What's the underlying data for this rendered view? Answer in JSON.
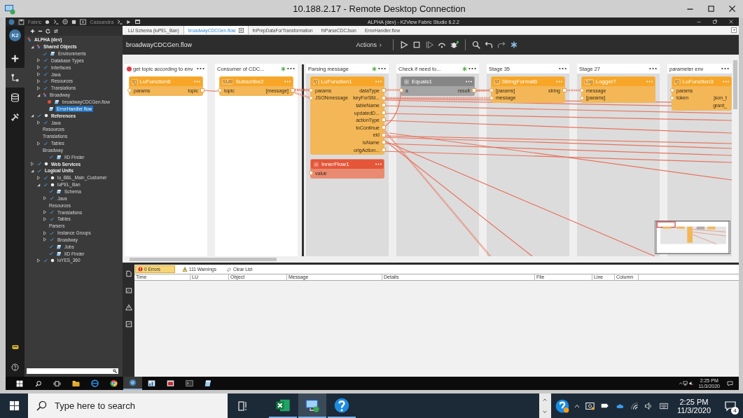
{
  "rdp_window": {
    "title": "10.188.2.17 - Remote Desktop Connection"
  },
  "app": {
    "labels": [
      "Fabric",
      "Cassandra"
    ],
    "title": "ALPHA (dev) - K2View Fabric Studio 6.2.2"
  },
  "rail": {
    "logo": "K2",
    "items": [
      {
        "kind": "add",
        "selected": false
      },
      {
        "kind": "flow",
        "selected": true
      },
      {
        "kind": "database",
        "selected": false
      },
      {
        "kind": "tools",
        "selected": false
      }
    ]
  },
  "tree": {
    "items": [
      {
        "label": "ALPHA (dev)",
        "kind": "project",
        "checked": false,
        "selected": false,
        "children": [
          {
            "label": "Shared Objects",
            "kind": "project",
            "checked": false,
            "selected": false,
            "expanded": true,
            "children": [
              {
                "label": "Environments",
                "kind": "file",
                "checked": true,
                "selected": false
              },
              {
                "label": "Database Types",
                "kind": "folder",
                "checked": true,
                "selected": false,
                "expanded": false
              },
              {
                "label": "Interfaces",
                "kind": "folder",
                "checked": true,
                "selected": false,
                "expanded": false
              },
              {
                "label": "Java",
                "kind": "folder",
                "checked": true,
                "selected": false,
                "expanded": false
              },
              {
                "label": "Resources",
                "kind": "folder",
                "checked": true,
                "selected": false,
                "expanded": false
              },
              {
                "label": "Translations",
                "kind": "folder",
                "checked": true,
                "selected": false,
                "expanded": false
              },
              {
                "label": "Broadway",
                "kind": "project",
                "checked": false,
                "selected": false,
                "expanded": true,
                "children": [
                  {
                    "label": "broadwayCDCGen.flow",
                    "kind": "file",
                    "checked": false,
                    "modified": true,
                    "selected": false
                  },
                  {
                    "label": "ErrorHandler.flow",
                    "kind": "file",
                    "checked": false,
                    "modified": false,
                    "selected": true
                  }
                ]
              }
            ]
          },
          {
            "label": "References",
            "kind": "dot",
            "checked": true,
            "selected": false,
            "expanded": true,
            "children": [
              {
                "label": "Java",
                "kind": "folder",
                "checked": true,
                "selected": false,
                "expanded": false
              },
              {
                "label": "Resources",
                "kind": "text",
                "checked": false,
                "selected": false
              },
              {
                "label": "Translations",
                "kind": "text",
                "checked": false,
                "selected": false
              },
              {
                "label": "Tables",
                "kind": "folder",
                "checked": true,
                "selected": false,
                "expanded": false
              },
              {
                "label": "Broadway",
                "kind": "text",
                "checked": false,
                "selected": false,
                "children": [
                  {
                    "label": "IID Finder",
                    "kind": "file",
                    "checked": true,
                    "selected": false
                  }
                ]
              }
            ]
          },
          {
            "label": "Web Services",
            "kind": "dot",
            "checked": true,
            "selected": false,
            "expanded": false
          },
          {
            "label": "Logical Units",
            "kind": "text",
            "checked": true,
            "selected": false,
            "expanded": true,
            "children": [
              {
                "label": "lu_BBL_Main_Customer",
                "kind": "dot",
                "checked": true,
                "selected": false,
                "expanded": false
              },
              {
                "label": "luPEL_Ban",
                "kind": "dot",
                "checked": true,
                "selected": false,
                "expanded": true,
                "children": [
                  {
                    "label": "Schema",
                    "kind": "file",
                    "checked": true,
                    "selected": false
                  },
                  {
                    "label": "Java",
                    "kind": "folder",
                    "checked": true,
                    "selected": false,
                    "expanded": false
                  },
                  {
                    "label": "Resources",
                    "kind": "text",
                    "checked": false,
                    "selected": false
                  },
                  {
                    "label": "Translations",
                    "kind": "folder",
                    "checked": true,
                    "selected": false,
                    "expanded": false
                  },
                  {
                    "label": "Tables",
                    "kind": "folder",
                    "checked": true,
                    "selected": false,
                    "expanded": false
                  },
                  {
                    "label": "Parsers",
                    "kind": "text",
                    "checked": false,
                    "selected": false
                  },
                  {
                    "label": "Instance Groups",
                    "kind": "folder",
                    "checked": true,
                    "selected": false,
                    "expanded": false
                  },
                  {
                    "label": "Broadway",
                    "kind": "folder",
                    "checked": true,
                    "selected": false,
                    "expanded": false
                  },
                  {
                    "label": "Jobs",
                    "kind": "file",
                    "checked": true,
                    "selected": false
                  },
                  {
                    "label": "IID Finder",
                    "kind": "file",
                    "checked": true,
                    "selected": false
                  }
                ]
              },
              {
                "label": "luYES_360",
                "kind": "dot",
                "checked": true,
                "selected": false,
                "expanded": false
              }
            ]
          }
        ]
      }
    ]
  },
  "tabs": [
    {
      "label": "LU Schema (luPEL_Ban)",
      "selected": false,
      "closable": false
    },
    {
      "label": "broadwayCDCGen.flow",
      "selected": true,
      "closable": true
    },
    {
      "label": "fnPrepDataForTransformation",
      "selected": false,
      "closable": false
    },
    {
      "label": "fnParseCDCJson",
      "selected": false,
      "closable": false
    },
    {
      "label": "ErrorHandler.flow",
      "selected": false,
      "closable": false
    }
  ],
  "flow": {
    "title": "broadwayCDCGen.flow",
    "actions": "Actions"
  },
  "stages": [
    {
      "title": "get  topic according to env",
      "error": true,
      "starred": false,
      "shaded": false,
      "divider_before": false,
      "nodes": [
        {
          "kind": "function",
          "badge": "f()",
          "title": "LuFunction6",
          "rows": [
            {
              "in": "params",
              "out": "topic"
            }
          ]
        }
      ]
    },
    {
      "title": "Consumer of CDC...",
      "error": false,
      "starred": true,
      "shaded": false,
      "divider_before": false,
      "nodes": [
        {
          "kind": "function",
          "badge": "SUB",
          "title": "Subscribe2",
          "rows": [
            {
              "in": "topic",
              "out": "[message]"
            }
          ]
        }
      ]
    },
    {
      "title": "Parsing message",
      "error": false,
      "starred": true,
      "shaded": true,
      "divider_before": true,
      "nodes": [
        {
          "kind": "function",
          "badge": "f()",
          "title": "LuFunction1",
          "rows": [
            {
              "in": "params",
              "out": "dataType"
            },
            {
              "in": "JSONmessage",
              "out": "keyForSfd..."
            },
            {
              "out": "tableName"
            },
            {
              "out": "updatedD..."
            },
            {
              "out": "actionType"
            },
            {
              "out": "toContinue"
            },
            {
              "out": "eid"
            },
            {
              "out": "luName"
            },
            {
              "out": "origAction..."
            }
          ]
        },
        {
          "kind": "inner_flow",
          "title": "InnerFlow1",
          "rows": [
            {
              "in": "value"
            }
          ]
        }
      ]
    },
    {
      "title": "Check if need to...",
      "error": false,
      "starred": true,
      "shaded": true,
      "divider_before": false,
      "nodes": [
        {
          "kind": "condition",
          "title": "Equals1",
          "rows": [
            {
              "in": "a",
              "out": "result"
            }
          ]
        }
      ]
    },
    {
      "title": "Stage 35",
      "error": false,
      "starred": false,
      "shaded": true,
      "divider_before": false,
      "nodes": [
        {
          "kind": "function",
          "badge": "Sf",
          "title": "StringFormat6",
          "rows": [
            {
              "in": "[params]",
              "out": "string"
            },
            {
              "in": "message"
            }
          ]
        }
      ]
    },
    {
      "title": "Stage 27",
      "error": false,
      "starred": false,
      "shaded": true,
      "divider_before": false,
      "nodes": [
        {
          "kind": "function",
          "badge": "Log",
          "title": "Logger7",
          "rows": [
            {
              "in": "message"
            },
            {
              "in": "[params]"
            }
          ]
        }
      ]
    },
    {
      "title": "parameter env",
      "error": false,
      "starred": false,
      "shaded": true,
      "divider_before": false,
      "nodes": [
        {
          "kind": "function",
          "badge": "f()",
          "title": "LuFunction3",
          "rows": [
            {
              "in": "params"
            },
            {
              "in": "token",
              "out": "json_t"
            },
            {
              "out": "grant_"
            }
          ]
        }
      ]
    }
  ],
  "problems": {
    "errors": {
      "label": "0 Errors",
      "selected": true
    },
    "warnings": {
      "label": "111 Warnings",
      "selected": false
    },
    "clear": "Clear List",
    "columns": [
      "Time",
      "LU",
      "Object",
      "Message",
      "Details",
      "File",
      "Line",
      "Column"
    ]
  },
  "remote_taskbar": {
    "apps": [
      {
        "kind": "folder",
        "selected": false
      },
      {
        "kind": "globe",
        "selected": false
      },
      {
        "kind": "wheel",
        "selected": false
      },
      {
        "kind": "logo",
        "selected": true
      },
      {
        "kind": "chart",
        "selected": false
      },
      {
        "kind": "window",
        "selected": false
      },
      {
        "kind": "terminal",
        "selected": false
      },
      {
        "kind": "note",
        "selected": false
      }
    ],
    "time": "2:25 PM",
    "date": "11/3/2020"
  },
  "taskbar": {
    "search_placeholder": "Type here to search",
    "apps": [
      {
        "kind": "sheet",
        "selected": false
      },
      {
        "kind": "monitor",
        "selected": true
      },
      {
        "kind": "help",
        "selected": false
      }
    ],
    "time": "2:25 PM",
    "date": "11/3/2020",
    "notifications": "4"
  }
}
